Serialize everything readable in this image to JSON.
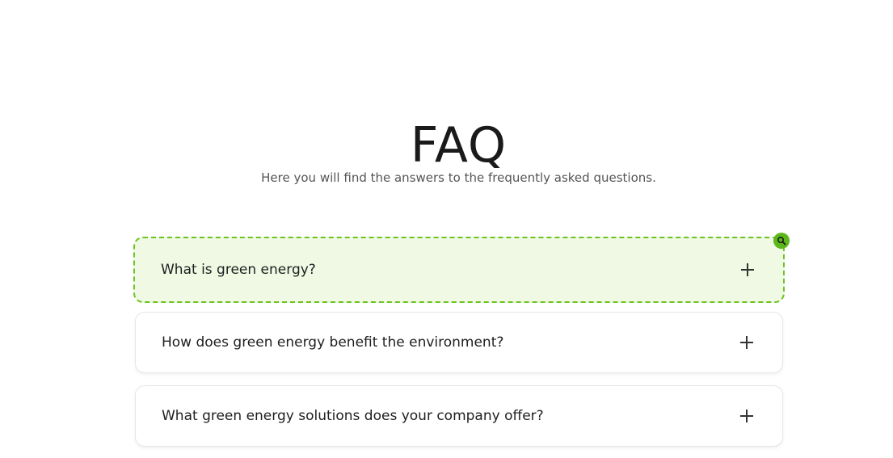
{
  "header": {
    "title": "FAQ",
    "subtitle": "Here you will find the answers to the frequently asked questions."
  },
  "faq": {
    "items": [
      {
        "question": "What is green energy?",
        "highlighted": true
      },
      {
        "question": "How does green energy benefit the environment?",
        "highlighted": false
      },
      {
        "question": "What green energy solutions does your company offer?",
        "highlighted": false
      }
    ]
  },
  "colors": {
    "highlight_border": "#6cc41d",
    "highlight_background": "#eff9e4",
    "badge": "#5cb81a"
  },
  "icons": {
    "expand": "plus-icon",
    "badge": "magnifier-icon"
  }
}
